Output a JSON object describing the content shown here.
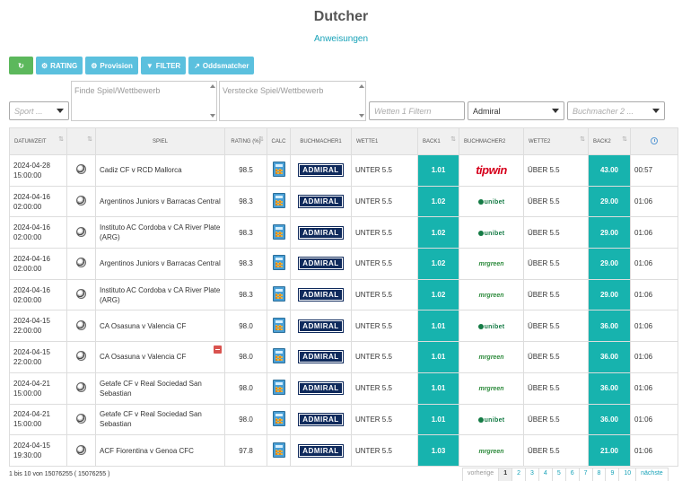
{
  "header": {
    "title": "Dutcher",
    "subtitle": "Anweisungen"
  },
  "toolbar": {
    "rating": "RATING",
    "provision": "Provision",
    "filter": "FILTER",
    "oddsmatcher": "Oddsmatcher"
  },
  "filters": {
    "sport_placeholder": "Sport ...",
    "find_placeholder": "Finde Spiel/Wettbewerb",
    "hide_placeholder": "Verstecke Spiel/Wettbewerb",
    "bet_placeholder": "Wetten 1 Filtern",
    "bookmaker1_value": "Admiral",
    "bookmaker2_placeholder": "Buchmacher 2 ..."
  },
  "columns": {
    "datetime": "DATUM/ZEIT",
    "spiel": "SPIEL",
    "rating": "RATING (%)",
    "calc": "CALC",
    "bm1": "BUCHMACHER1",
    "wette1": "WETTE1",
    "back1": "BACK1",
    "bm2": "BUCHMACHER2",
    "wette2": "WETTE2",
    "back2": "BACK2"
  },
  "rows": [
    {
      "date": "2024-04-28",
      "time": "15:00:00",
      "game": "Cadiz CF v RCD Mallorca",
      "rating": "98.5",
      "bm1": "ADMIRAL",
      "bet1": "UNTER 5.5",
      "back1": "1.01",
      "bm2": "tipwin",
      "bet2": "ÜBER 5.5",
      "back2": "43.00",
      "rem": "00:57"
    },
    {
      "date": "2024-04-16",
      "time": "02:00:00",
      "game": "Argentinos Juniors v Barracas Central",
      "rating": "98.3",
      "bm1": "ADMIRAL",
      "bet1": "UNTER 5.5",
      "back1": "1.02",
      "bm2": "unibet",
      "bet2": "ÜBER 5.5",
      "back2": "29.00",
      "rem": "01:06"
    },
    {
      "date": "2024-04-16",
      "time": "02:00:00",
      "game": "Instituto AC Cordoba v CA River Plate (ARG)",
      "rating": "98.3",
      "bm1": "ADMIRAL",
      "bet1": "UNTER 5.5",
      "back1": "1.02",
      "bm2": "unibet",
      "bet2": "ÜBER 5.5",
      "back2": "29.00",
      "rem": "01:06"
    },
    {
      "date": "2024-04-16",
      "time": "02:00:00",
      "game": "Argentinos Juniors v Barracas Central",
      "rating": "98.3",
      "bm1": "ADMIRAL",
      "bet1": "UNTER 5.5",
      "back1": "1.02",
      "bm2": "mrgreen",
      "bet2": "ÜBER 5.5",
      "back2": "29.00",
      "rem": "01:06"
    },
    {
      "date": "2024-04-16",
      "time": "02:00:00",
      "game": "Instituto AC Cordoba v CA River Plate (ARG)",
      "rating": "98.3",
      "bm1": "ADMIRAL",
      "bet1": "UNTER 5.5",
      "back1": "1.02",
      "bm2": "mrgreen",
      "bet2": "ÜBER 5.5",
      "back2": "29.00",
      "rem": "01:06"
    },
    {
      "date": "2024-04-15",
      "time": "22:00:00",
      "game": "CA Osasuna v Valencia CF",
      "rating": "98.0",
      "bm1": "ADMIRAL",
      "bet1": "UNTER 5.5",
      "back1": "1.01",
      "bm2": "unibet",
      "bet2": "ÜBER 5.5",
      "back2": "36.00",
      "rem": "01:06"
    },
    {
      "date": "2024-04-15",
      "time": "22:00:00",
      "game": "CA Osasuna v Valencia CF",
      "rating": "98.0",
      "bm1": "ADMIRAL",
      "bet1": "UNTER 5.5",
      "back1": "1.01",
      "bm2": "mrgreen",
      "bet2": "ÜBER 5.5",
      "back2": "36.00",
      "rem": "01:06",
      "minus": true
    },
    {
      "date": "2024-04-21",
      "time": "15:00:00",
      "game": "Getafe CF v Real Sociedad San Sebastian",
      "rating": "98.0",
      "bm1": "ADMIRAL",
      "bet1": "UNTER 5.5",
      "back1": "1.01",
      "bm2": "mrgreen",
      "bet2": "ÜBER 5.5",
      "back2": "36.00",
      "rem": "01:06"
    },
    {
      "date": "2024-04-21",
      "time": "15:00:00",
      "game": "Getafe CF v Real Sociedad San Sebastian",
      "rating": "98.0",
      "bm1": "ADMIRAL",
      "bet1": "UNTER 5.5",
      "back1": "1.01",
      "bm2": "unibet",
      "bet2": "ÜBER 5.5",
      "back2": "36.00",
      "rem": "01:06"
    },
    {
      "date": "2024-04-15",
      "time": "19:30:00",
      "game": "ACF Fiorentina v Genoa CFC",
      "rating": "97.8",
      "bm1": "ADMIRAL",
      "bet1": "UNTER 5.5",
      "back1": "1.03",
      "bm2": "mrgreen",
      "bet2": "ÜBER 5.5",
      "back2": "21.00",
      "rem": "01:06"
    }
  ],
  "footer": {
    "info": "1 bis 10 von 15076255 ( 15076255 )",
    "prev": "vorherige",
    "pages": [
      "1",
      "2",
      "3",
      "4",
      "5",
      "6",
      "7",
      "8",
      "9",
      "10"
    ],
    "next": "nächste"
  },
  "colors": {
    "accent": "#17a2b8",
    "back_cell": "#17b3ae",
    "refresh": "#5cb85c",
    "toolbar": "#5bc0de"
  }
}
